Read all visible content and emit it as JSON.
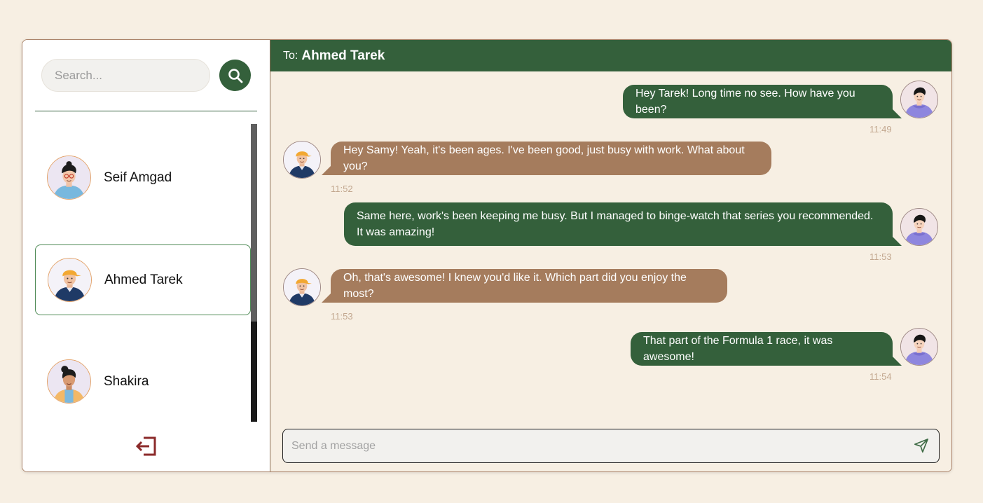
{
  "search": {
    "placeholder": "Search..."
  },
  "contacts": [
    {
      "name": "Seif Amgad",
      "avatar": "boy-glasses-avatar",
      "selected": false
    },
    {
      "name": "Ahmed Tarek",
      "avatar": "boy-cap-avatar",
      "selected": true
    },
    {
      "name": "Shakira",
      "avatar": "girl-bun-avatar",
      "selected": false
    }
  ],
  "chat": {
    "to_label": "To:",
    "recipient": "Ahmed Tarek",
    "messages": [
      {
        "direction": "sent",
        "text": "Hey Tarek! Long time no see. How have you been?",
        "time": "11:49"
      },
      {
        "direction": "received",
        "text": "Hey Samy! Yeah, it's been ages. I've been good, just busy with work. What about you?",
        "time": "11:52"
      },
      {
        "direction": "sent",
        "text": "Same here, work's been keeping me busy. But I managed to binge-watch that series you recommended. It was amazing!",
        "time": "11:53"
      },
      {
        "direction": "received",
        "text": "Oh, that's awesome! I knew you'd like it. Which part did you enjoy the most?",
        "time": "11:53"
      },
      {
        "direction": "sent",
        "text": "That part of the Formula 1 race, it was awesome!",
        "time": "11:54"
      }
    ],
    "compose_placeholder": "Send a message"
  },
  "colors": {
    "background": "#f7efe3",
    "primary_green": "#34603b",
    "received_brown": "#a57c5d",
    "timestamp": "#c2a78f",
    "logout_red": "#8b2a2a"
  },
  "icons": {
    "search": "search-icon",
    "logout": "logout-icon",
    "send": "send-icon"
  }
}
